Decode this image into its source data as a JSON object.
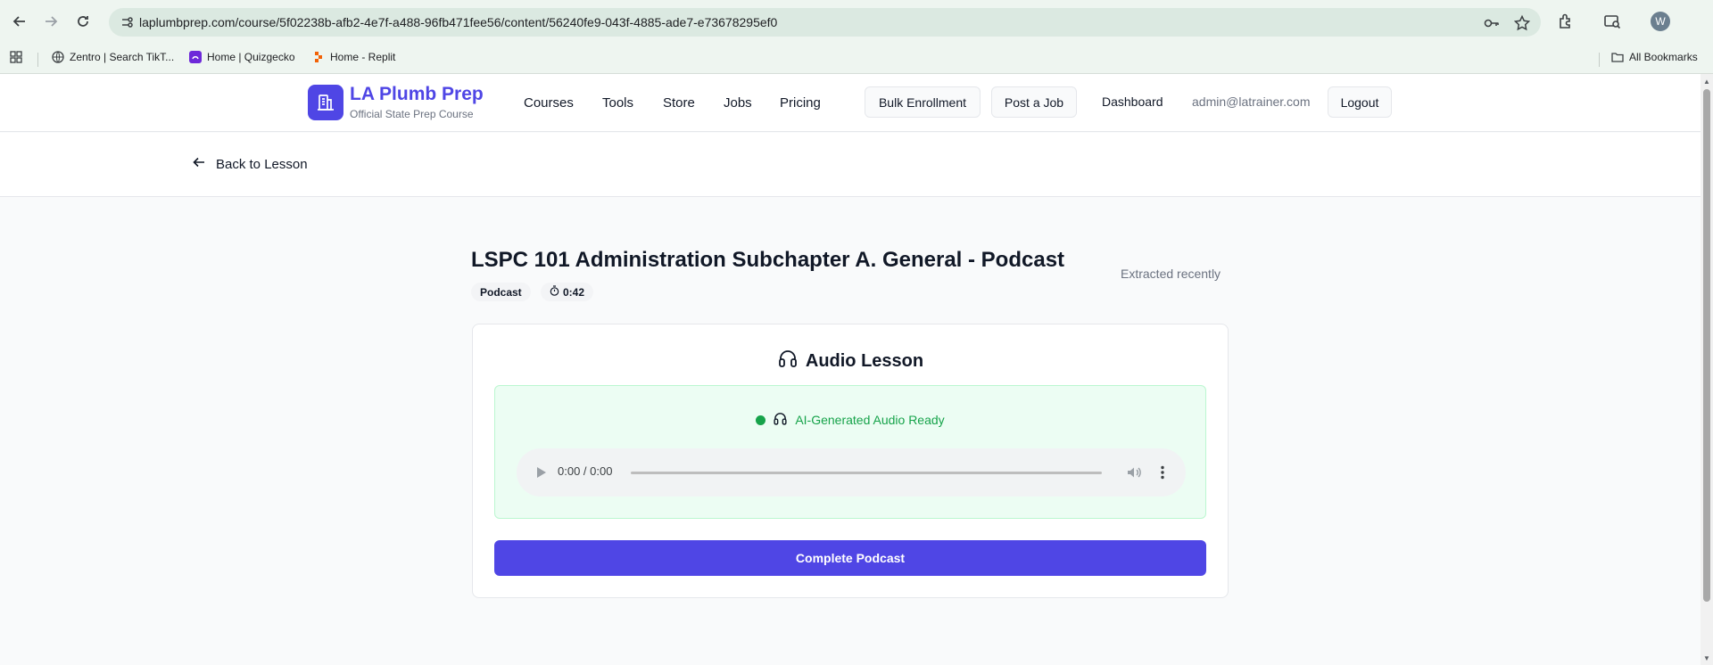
{
  "browser": {
    "url": "laplumbprep.com/course/5f02238b-afb2-4e7f-a488-96fb471fee56/content/56240fe9-043f-4885-ade7-e73678295ef0",
    "avatar_initial": "W",
    "bookmarks": [
      {
        "label": "Zentro | Search TikT...",
        "icon": "globe-icon"
      },
      {
        "label": "Home | Quizgecko",
        "icon": "quizgecko-icon"
      },
      {
        "label": "Home - Replit",
        "icon": "replit-icon"
      }
    ],
    "all_bookmarks_label": "All Bookmarks"
  },
  "header": {
    "brand": "LA Plumb Prep",
    "tagline": "Official State Prep Course",
    "nav": [
      "Courses",
      "Tools",
      "Store",
      "Jobs",
      "Pricing"
    ],
    "bulk_enrollment": "Bulk Enrollment",
    "post_job": "Post a Job",
    "dashboard": "Dashboard",
    "user_email": "admin@latrainer.com",
    "logout": "Logout"
  },
  "back": {
    "label": "Back to Lesson"
  },
  "content": {
    "title": "LSPC 101 Administration Subchapter A. General - Podcast",
    "type_badge": "Podcast",
    "duration_badge": "0:42",
    "extracted": "Extracted recently"
  },
  "audio_card": {
    "title": "Audio Lesson",
    "status": "AI-Generated Audio Ready",
    "player_time": "0:00 / 0:00",
    "progress": 0,
    "complete_button": "Complete Podcast"
  },
  "colors": {
    "brand": "#4f46e5",
    "status_green": "#16a34a",
    "panel_bg": "#ecfdf3"
  }
}
